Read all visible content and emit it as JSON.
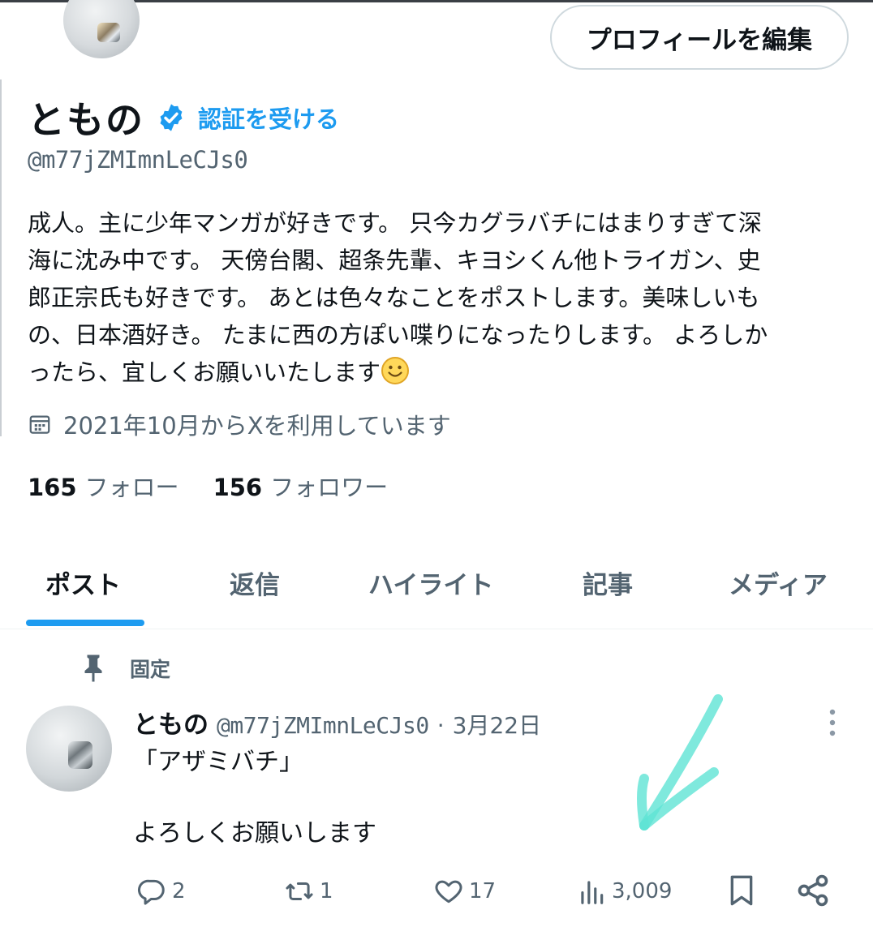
{
  "profile": {
    "display_name": "ともの",
    "verify_link": "認証を受ける",
    "handle": "@m77jZMImnLeCJs0",
    "edit_button": "プロフィールを編集",
    "bio_lines": [
      "成人。主に少年マンガが好きです。 只今カグラバチにはまりすぎて深",
      "海に沈み中です。 天傍台閣、超条先輩、キヨシくん他トライガン、史",
      "郎正宗氏も好きです。 あとは色々なことをポストします。美味しいも",
      "の、日本酒好き。 たまに西の方ぽい喋りになったりします。 よろしか",
      "ったら、宜しくお願いいたします"
    ],
    "bio_emoji": "smiling-face-emoji",
    "joined": "2021年10月からXを利用しています",
    "following_count": "165",
    "following_label": "フォロー",
    "followers_count": "156",
    "followers_label": "フォロワー"
  },
  "tabs": [
    {
      "label": "ポスト",
      "active": true
    },
    {
      "label": "返信",
      "active": false
    },
    {
      "label": "ハイライト",
      "active": false
    },
    {
      "label": "記事",
      "active": false
    },
    {
      "label": "メディア",
      "active": false
    }
  ],
  "pinned_label": "固定",
  "post": {
    "author": "ともの",
    "handle": "@m77jZMImnLeCJs0",
    "separator": "·",
    "date": "3月22日",
    "line1": "「アザミバチ」",
    "line2": "よろしくお願いします",
    "replies": "2",
    "reposts": "1",
    "likes": "17",
    "views": "3,009"
  },
  "icons": {
    "verified": "verified-badge-icon",
    "calendar": "calendar-icon",
    "pin": "pin-icon",
    "more": "more-vertical-icon",
    "reply": "reply-icon",
    "repost": "repost-icon",
    "like": "heart-icon",
    "views": "views-bar-chart-icon",
    "bookmark": "bookmark-icon",
    "share": "share-icon",
    "annotation": "hand-drawn-arrow"
  },
  "colors": {
    "accent": "#1d9bf0",
    "text": "#0f1419",
    "muted": "#536471",
    "annotation": "#5fe3d4"
  }
}
